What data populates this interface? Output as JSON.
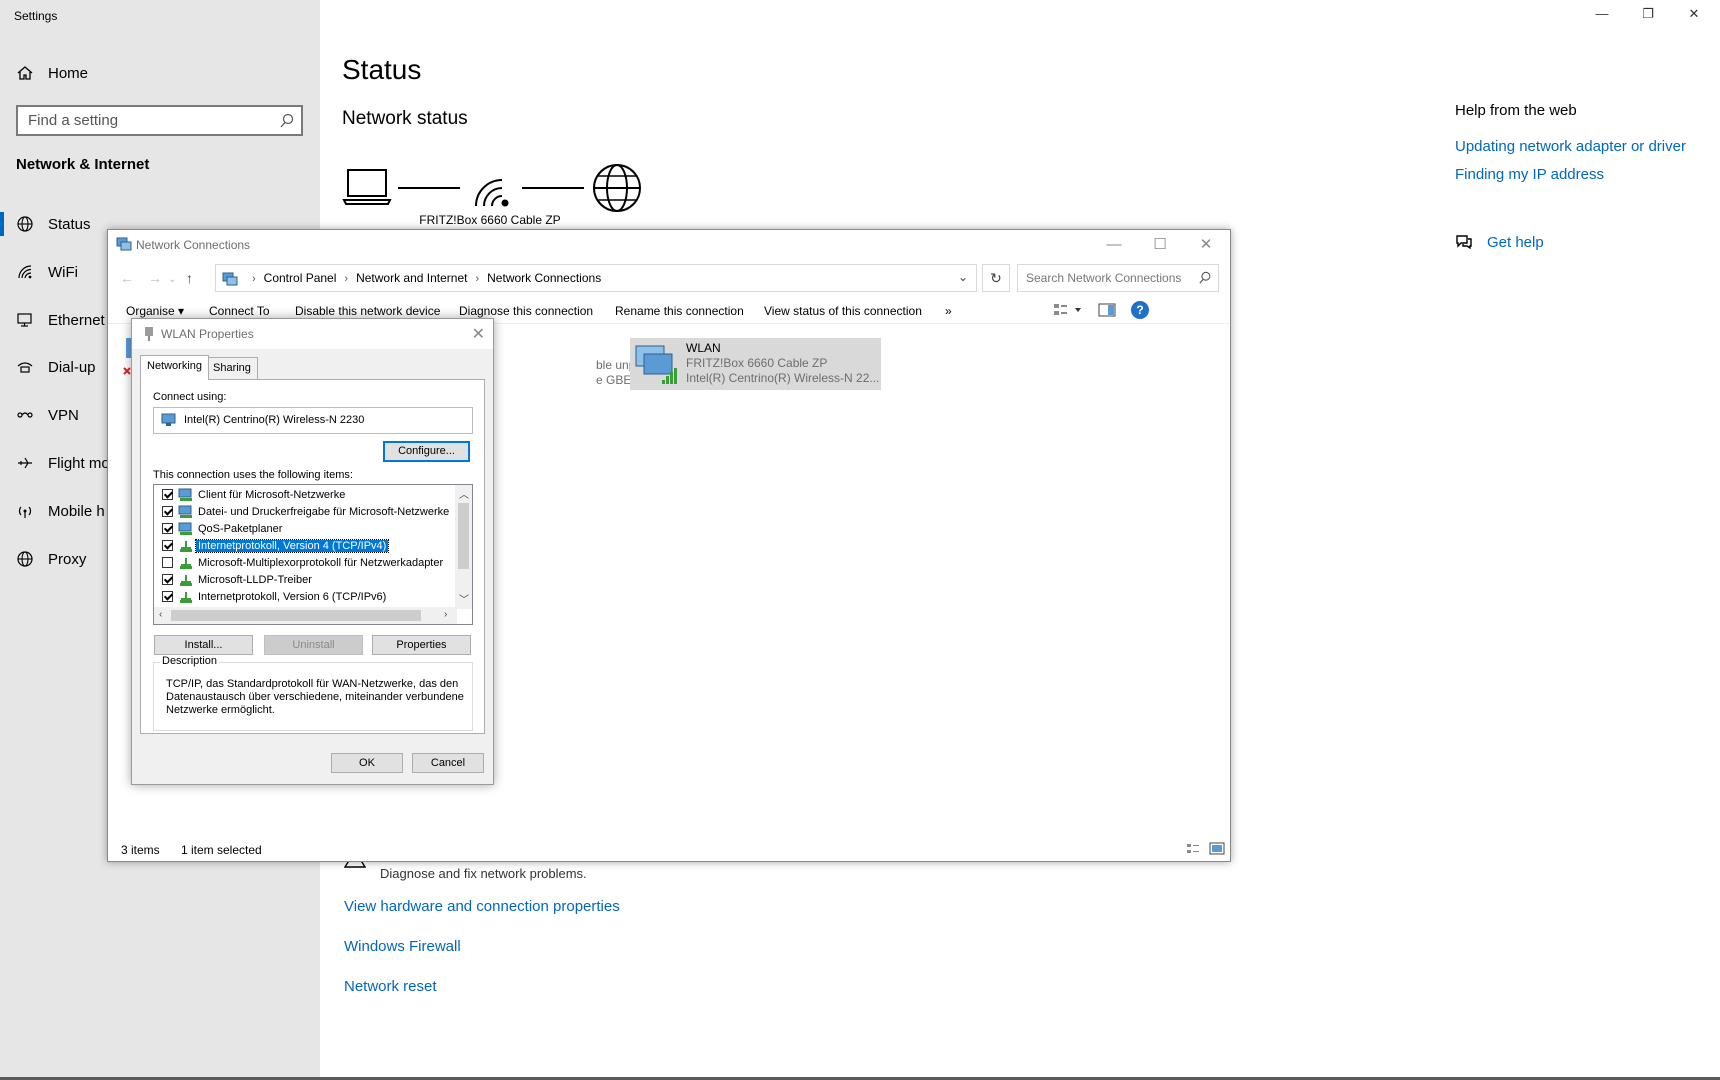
{
  "settings": {
    "window_title": "Settings",
    "home_label": "Home",
    "search_placeholder": "Find a setting",
    "section_title": "Network & Internet",
    "nav_items": [
      {
        "label": "Status",
        "icon": "globe-icon"
      },
      {
        "label": "WiFi",
        "icon": "wifi-icon"
      },
      {
        "label": "Ethernet",
        "icon": "ethernet-icon"
      },
      {
        "label": "Dial-up",
        "icon": "dialup-icon"
      },
      {
        "label": "VPN",
        "icon": "vpn-icon"
      },
      {
        "label": "Flight mo",
        "icon": "airplane-icon"
      },
      {
        "label": "Mobile h",
        "icon": "hotspot-icon"
      },
      {
        "label": "Proxy",
        "icon": "globe-icon"
      }
    ],
    "main_title": "Status",
    "main_subtitle": "Network status",
    "router_label": "FRITZ!Box 6660 Cable ZP",
    "help_heading": "Help from the web",
    "help_links": [
      "Updating network adapter or driver",
      "Finding my IP address"
    ],
    "get_help": "Get help",
    "diagnose_sub": "Diagnose and fix network problems.",
    "links": [
      "View hardware and connection properties",
      "Windows Firewall",
      "Network reset"
    ],
    "accent_color": "#0067c0"
  },
  "netconn": {
    "title": "Network Connections",
    "breadcrumb": [
      "Control Panel",
      "Network and Internet",
      "Network Connections"
    ],
    "search_placeholder": "Search Network Connections",
    "toolbar": [
      "Organise ▾",
      "Connect To",
      "Disable this network device",
      "Diagnose this connection",
      "Rename this connection",
      "View status of this connection",
      "»"
    ],
    "ethernet": {
      "status": "ble unplugged",
      "adapter": "e GBE Family Controller"
    },
    "wlan": {
      "name": "WLAN",
      "network": "FRITZ!Box 6660 Cable ZP",
      "adapter": "Intel(R) Centrino(R) Wireless-N 22..."
    },
    "status_count": "3 items",
    "status_selected": "1 item selected"
  },
  "wlan_props": {
    "title": "WLAN Properties",
    "tabs": [
      "Networking",
      "Sharing"
    ],
    "connect_using_label": "Connect using:",
    "adapter": "Intel(R) Centrino(R) Wireless-N 2230",
    "configure": "Configure...",
    "items_label": "This connection uses the following items:",
    "items": [
      {
        "label": "Client für Microsoft-Netzwerke",
        "checked": true,
        "selected": false
      },
      {
        "label": "Datei- und Druckerfreigabe für Microsoft-Netzwerke",
        "checked": true,
        "selected": false
      },
      {
        "label": "QoS-Paketplaner",
        "checked": true,
        "selected": false
      },
      {
        "label": "Internetprotokoll, Version 4 (TCP/IPv4)",
        "checked": true,
        "selected": true
      },
      {
        "label": "Microsoft-Multiplexorprotokoll für Netzwerkadapter",
        "checked": false,
        "selected": false
      },
      {
        "label": "Microsoft-LLDP-Treiber",
        "checked": true,
        "selected": false
      },
      {
        "label": "Internetprotokoll, Version 6 (TCP/IPv6)",
        "checked": true,
        "selected": false
      }
    ],
    "install": "Install...",
    "uninstall": "Uninstall",
    "properties": "Properties",
    "description_title": "Description",
    "description": "TCP/IP, das Standardprotokoll für WAN-Netzwerke, das den Datenaustausch über verschiedene, miteinander verbundene Netzwerke ermöglicht.",
    "ok": "OK",
    "cancel": "Cancel"
  }
}
